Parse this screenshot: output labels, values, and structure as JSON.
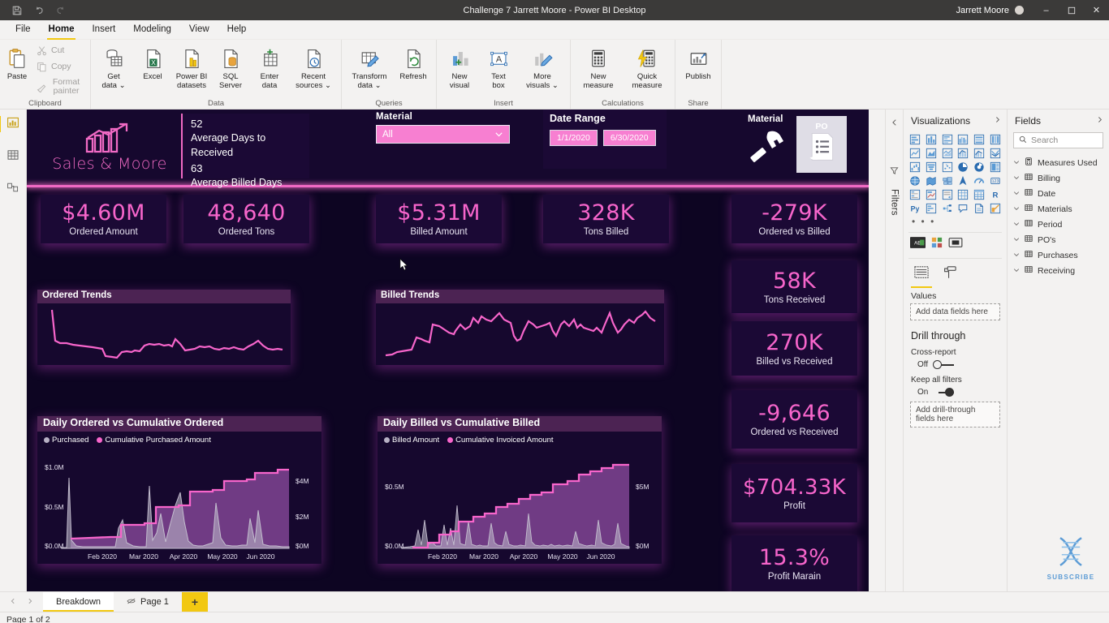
{
  "titlebar": {
    "title": "Challenge 7 Jarrett Moore - Power BI Desktop",
    "user": "Jarrett Moore",
    "save_icon": "save-icon",
    "undo_icon": "undo-icon",
    "redo_icon": "redo-icon",
    "minimize": "–",
    "maximize": "❐",
    "close": "✕"
  },
  "ribbon": {
    "tabs": [
      {
        "label": "File",
        "active": false
      },
      {
        "label": "Home",
        "active": true
      },
      {
        "label": "Insert",
        "active": false
      },
      {
        "label": "Modeling",
        "active": false
      },
      {
        "label": "View",
        "active": false
      },
      {
        "label": "Help",
        "active": false
      }
    ],
    "groups": [
      {
        "name": "Clipboard",
        "items": [
          {
            "label": "Paste",
            "icon": "paste-icon"
          },
          {
            "label": "Cut",
            "icon": "scissors-icon"
          },
          {
            "label": "Copy",
            "icon": "copy-icon"
          },
          {
            "label": "Format painter",
            "icon": "format-painter-icon"
          }
        ]
      },
      {
        "name": "Data",
        "items": [
          {
            "label": "Get data ⌄",
            "icon": "get-data-icon"
          },
          {
            "label": "Excel",
            "icon": "excel-icon"
          },
          {
            "label": "Power BI datasets",
            "icon": "powerbi-datasets-icon"
          },
          {
            "label": "SQL Server",
            "icon": "sql-server-icon"
          },
          {
            "label": "Enter data",
            "icon": "enter-data-icon"
          },
          {
            "label": "Recent sources ⌄",
            "icon": "recent-sources-icon"
          }
        ]
      },
      {
        "name": "Queries",
        "items": [
          {
            "label": "Transform data ⌄",
            "icon": "transform-data-icon"
          },
          {
            "label": "Refresh",
            "icon": "refresh-icon"
          }
        ]
      },
      {
        "name": "Insert",
        "items": [
          {
            "label": "New visual",
            "icon": "new-visual-icon"
          },
          {
            "label": "Text box",
            "icon": "text-box-icon"
          },
          {
            "label": "More visuals ⌄",
            "icon": "more-visuals-icon"
          }
        ]
      },
      {
        "name": "Calculations",
        "items": [
          {
            "label": "New measure",
            "icon": "new-measure-icon"
          },
          {
            "label": "Quick measure",
            "icon": "quick-measure-icon"
          }
        ]
      },
      {
        "name": "Share",
        "items": [
          {
            "label": "Publish",
            "icon": "publish-icon"
          }
        ]
      }
    ],
    "labels": {
      "paste": "Paste",
      "cut": "Cut",
      "copy": "Copy",
      "format_painter": "Format painter",
      "get_data": "Get",
      "get_data2": "data ⌄",
      "excel": "Excel",
      "excel2": "",
      "pbi": "Power BI",
      "pbi2": "datasets",
      "sql": "SQL",
      "sql2": "Server",
      "enter": "Enter",
      "enter2": "data",
      "recent": "Recent",
      "recent2": "sources ⌄",
      "transform": "Transform",
      "transform2": "data ⌄",
      "refresh": "Refresh",
      "refresh2": "",
      "newvisual": "New",
      "newvisual2": "visual",
      "textbox": "Text",
      "textbox2": "box",
      "morevisuals": "More",
      "morevisuals2": "visuals ⌄",
      "newmeasure": "New",
      "newmeasure2": "measure",
      "quickmeasure": "Quick",
      "quickmeasure2": "measure",
      "publish": "Publish",
      "publish2": "",
      "g_clipboard": "Clipboard",
      "g_data": "Data",
      "g_queries": "Queries",
      "g_insert": "Insert",
      "g_calculations": "Calculations",
      "g_share": "Share"
    }
  },
  "leftrail": {
    "items": [
      {
        "name": "report-view",
        "icon": "report-chart-icon",
        "active": true
      },
      {
        "name": "data-view",
        "icon": "table-grid-icon",
        "active": false
      },
      {
        "name": "model-view",
        "icon": "model-relationship-icon",
        "active": false
      }
    ]
  },
  "report": {
    "brand": {
      "name": "Sales & Moore",
      "logo_icon": "bar-chart-arrow-icon"
    },
    "averages": [
      {
        "value": "52",
        "label": "Average Days to Received"
      },
      {
        "value": "63",
        "label": "Average Billed Days"
      }
    ],
    "slicer": {
      "label": "Material",
      "value": "All",
      "chevron_icon": "chevron-down-icon"
    },
    "date_range": {
      "label": "Date Range",
      "start": "1/1/2020",
      "end": "6/30/2020"
    },
    "material_po": {
      "label": "Material",
      "hammer_icon": "hammer-icon",
      "po_label": "PO",
      "po_icon": "clipboard-list-icon"
    },
    "kpis_top": [
      {
        "value": "$4.60M",
        "label": "Ordered Amount"
      },
      {
        "value": "48,640",
        "label": "Ordered Tons"
      },
      {
        "value": "$5.31M",
        "label": "Billed Amount"
      },
      {
        "value": "328K",
        "label": "Tons Billed"
      },
      {
        "value": "-279K",
        "label": "Ordered vs Billed"
      }
    ],
    "kpis_right": [
      {
        "value": "58K",
        "label": "Tons Received"
      },
      {
        "value": "270K",
        "label": "Billed vs Received"
      },
      {
        "value": "-9,646",
        "label": "Ordered vs Received"
      },
      {
        "value": "$704.33K",
        "label": "Profit"
      },
      {
        "value": "15.3%",
        "label": "Profit Marain"
      }
    ],
    "trends": [
      {
        "title": "Ordered Trends"
      },
      {
        "title": "Billed Trends"
      }
    ],
    "subscribe": {
      "label": "SUBSCRIBE",
      "icon": "dna-helix-icon"
    }
  },
  "chart_data": [
    {
      "type": "line",
      "title": "Ordered Trends",
      "xlabel": "",
      "ylabel": "",
      "legend": [],
      "grid": false,
      "series": [
        {
          "name": "Ordered",
          "color": "#f765cb",
          "values": [
            98,
            62,
            58,
            57,
            55,
            53,
            50,
            49,
            48,
            47,
            46,
            30,
            28,
            27,
            36,
            35,
            34,
            33,
            35,
            34,
            33,
            32,
            44,
            45,
            46,
            45,
            44,
            43,
            44,
            43,
            42,
            52,
            48,
            34,
            33,
            32,
            33,
            32,
            40,
            41,
            40,
            39,
            38,
            37,
            36,
            40,
            41,
            40,
            39,
            38,
            37,
            36,
            35,
            34,
            33,
            32,
            31,
            30,
            32,
            34,
            36,
            38,
            40,
            42,
            40,
            48,
            52,
            44,
            36,
            34,
            33,
            32,
            31,
            32,
            33,
            32
          ]
        }
      ]
    },
    {
      "type": "line",
      "title": "Billed Trends",
      "xlabel": "",
      "ylabel": "",
      "legend": [],
      "grid": false,
      "series": [
        {
          "name": "Billed",
          "color": "#f765cb",
          "values": [
            8,
            9,
            10,
            14,
            15,
            16,
            15,
            14,
            32,
            30,
            28,
            27,
            26,
            48,
            50,
            46,
            44,
            42,
            40,
            38,
            40,
            54,
            52,
            50,
            48,
            62,
            46,
            50,
            58,
            62,
            70,
            66,
            72,
            70,
            68,
            66,
            78,
            74,
            66,
            64,
            68,
            66,
            30,
            26,
            32,
            36,
            34,
            62,
            66,
            56,
            52,
            50,
            52,
            54,
            50,
            58,
            60,
            56,
            48,
            62,
            44,
            56,
            58,
            60,
            56,
            54,
            52,
            58,
            52,
            50,
            46,
            78,
            60,
            52,
            48,
            44,
            42,
            58,
            62,
            60,
            66,
            72,
            70,
            64
          ]
        }
      ]
    },
    {
      "type": "area",
      "title": "Daily Ordered vs Cumulative Ordered",
      "xlabel": "",
      "ylabel": "",
      "legend": [
        "Purchased",
        "Cumulative Purchased Amount"
      ],
      "legend_position": "top",
      "grid": false,
      "x_ticks": [
        "Feb 2020",
        "Mar 2020",
        "Apr 2020",
        "May 2020",
        "Jun 2020"
      ],
      "y_left_ticks": [
        "$0.0M",
        "$0.5M",
        "$1.0M"
      ],
      "y_left_lim": [
        0,
        1000000
      ],
      "y_right_ticks": [
        "$0M",
        "$2M",
        "$4M"
      ],
      "y_right_lim": [
        0,
        5000000
      ],
      "series": [
        {
          "name": "Purchased",
          "color": "#b7b0c4",
          "values": [
            0.02,
            0.02,
            0.9,
            0.1,
            0.04,
            0.03,
            0.03,
            0.02,
            0.03,
            0.02,
            0.02,
            0.03,
            0.02,
            0.03,
            0.02,
            0.02,
            0.03,
            0.02,
            0.02,
            0.02,
            0.03,
            0.02,
            0.02,
            0.02,
            0.2,
            0.12,
            0.05,
            0.03,
            0.02,
            0.02,
            0.02,
            0.02,
            0.78,
            0.09,
            0.05,
            0.35,
            0.08,
            0.06,
            0.32,
            0.22,
            0.12,
            0.58,
            0.3,
            0.18,
            0.1,
            0.06,
            0.05,
            0.04,
            0.04,
            0.03,
            0.03,
            0.04,
            0.05,
            0.06,
            0.6,
            0.18,
            0.06,
            0.04,
            0.04,
            0.05,
            0.05,
            0.04,
            0.04,
            0.05,
            0.4,
            0.12,
            0.06,
            0.42,
            0.1,
            0.05,
            0.05,
            0.04,
            0.04,
            0.04,
            0.04,
            0.03,
            0.03,
            0.03
          ]
        },
        {
          "name": "Cumulative Purchased Amount",
          "color": "#f765cb",
          "values": [
            0.64,
            0.64,
            0.64,
            0.65,
            0.65,
            0.66,
            0.66,
            0.66,
            0.67,
            0.67,
            0.67,
            0.68,
            0.68,
            0.68,
            0.68,
            0.69,
            0.69,
            0.69,
            0.7,
            0.7,
            0.7,
            0.71,
            0.71,
            0.85,
            0.88,
            0.88,
            0.89,
            0.89,
            0.89,
            0.9,
            0.9,
            0.9,
            0.91,
            1.22,
            1.24,
            1.26,
            1.28,
            1.3,
            1.32,
            1.5,
            1.52,
            1.54,
            1.56,
            1.58,
            2.0,
            2.02,
            2.05,
            2.06,
            2.08,
            2.1,
            2.12,
            2.14,
            2.16,
            2.18,
            2.2,
            2.6,
            2.62,
            2.66,
            2.68,
            2.7,
            2.72,
            2.74,
            2.76,
            2.78,
            2.8,
            2.9,
            3.1,
            3.15,
            3.2,
            3.4,
            3.42,
            3.44,
            3.46,
            3.48,
            3.5,
            3.5,
            3.52,
            3.55
          ]
        }
      ]
    },
    {
      "type": "area",
      "title": "Daily Billed vs Cumulative Billed",
      "xlabel": "",
      "ylabel": "",
      "legend": [
        "Billed Amount",
        "Cumulative Invoiced Amount"
      ],
      "legend_position": "top",
      "grid": false,
      "x_ticks": [
        "Feb 2020",
        "Mar 2020",
        "Apr 2020",
        "May 2020",
        "Jun 2020"
      ],
      "y_left_ticks": [
        "$0.0M",
        "$0.5M"
      ],
      "y_left_lim": [
        0,
        600000
      ],
      "y_right_ticks": [
        "$0M",
        "$5M"
      ],
      "y_right_lim": [
        0,
        5500000
      ],
      "series": [
        {
          "name": "Billed Amount",
          "color": "#b7b0c4",
          "values": [
            0.03,
            0.03,
            0.04,
            0.04,
            0.05,
            0.3,
            0.1,
            0.48,
            0.12,
            0.06,
            0.1,
            0.06,
            0.05,
            0.08,
            0.05,
            0.06,
            0.4,
            0.12,
            0.06,
            0.05,
            0.36,
            0.1,
            0.06,
            0.72,
            0.14,
            0.08,
            0.06,
            0.05,
            0.52,
            0.14,
            0.06,
            0.06,
            0.05,
            0.06,
            0.05,
            0.1,
            0.06,
            0.5,
            0.18,
            0.06,
            0.05,
            0.05,
            0.26,
            0.1,
            0.06,
            0.05,
            0.05,
            0.06,
            0.05,
            0.6,
            0.22,
            0.08,
            0.06,
            0.05,
            0.06,
            0.05,
            0.06,
            0.06,
            0.05,
            0.05,
            0.06,
            0.26,
            0.1,
            0.06,
            0.05,
            0.06,
            0.05,
            0.44,
            0.14,
            0.06,
            0.05,
            0.06,
            0.4,
            0.12,
            0.06,
            0.05
          ]
        },
        {
          "name": "Cumulative Invoiced Amount",
          "color": "#f765cb",
          "values": [
            0.03,
            0.03,
            0.03,
            0.04,
            0.04,
            0.05,
            0.05,
            0.06,
            0.22,
            0.24,
            0.26,
            0.28,
            0.3,
            0.31,
            0.32,
            0.46,
            0.47,
            0.48,
            0.49,
            0.5,
            0.51,
            0.52,
            0.53,
            0.68,
            0.9,
            0.92,
            0.94,
            0.96,
            0.98,
            1.0,
            1.02,
            1.04,
            1.06,
            1.32,
            1.34,
            1.36,
            1.38,
            1.4,
            1.62,
            1.64,
            1.66,
            1.68,
            1.7,
            1.72,
            1.74,
            1.76,
            1.78,
            1.8,
            1.82,
            1.84,
            2.2,
            2.22,
            2.24,
            2.26,
            2.28,
            2.3,
            2.32,
            2.34,
            2.36,
            2.38,
            2.6,
            2.8,
            2.82,
            2.84,
            2.86,
            2.88,
            3.0,
            3.2,
            3.22,
            3.3,
            3.4,
            3.42,
            3.6,
            3.62,
            3.7,
            3.9
          ]
        }
      ]
    }
  ],
  "visualizations": {
    "title": "Visualizations",
    "collapse_icon": "chevron-left-icon",
    "expand_icon": "chevron-right-icon",
    "filters_label": "Filters",
    "filter_icon": "funnel-icon",
    "ellipsis": "• • •",
    "fieldwells": [
      {
        "name": "fields-well-tab",
        "icon": "fields-list-icon",
        "active": true
      },
      {
        "name": "format-well-tab",
        "icon": "paint-roller-icon",
        "active": false
      }
    ],
    "wells_label": "Values",
    "dropzone": "Add data fields here",
    "drill": {
      "title": "Drill through",
      "cross_report_label": "Cross-report",
      "cross_report_state": "Off",
      "keep_filters_label": "Keep all filters",
      "keep_filters_state": "On",
      "dropzone": "Add drill-through fields here"
    }
  },
  "fields": {
    "title": "Fields",
    "expand_icon": "chevron-right-icon",
    "search_placeholder": "Search",
    "search_icon": "search-icon",
    "tables": [
      {
        "label": "Measures Used",
        "icon": "measure-calculator-icon"
      },
      {
        "label": "Billing",
        "icon": "table-icon"
      },
      {
        "label": "Date",
        "icon": "table-icon"
      },
      {
        "label": "Materials",
        "icon": "table-icon"
      },
      {
        "label": "Period",
        "icon": "table-icon"
      },
      {
        "label": "PO's",
        "icon": "table-icon"
      },
      {
        "label": "Purchases",
        "icon": "table-icon"
      },
      {
        "label": "Receiving",
        "icon": "table-icon"
      }
    ]
  },
  "pagetabs": {
    "prev_icon": "chevron-left-icon",
    "next_icon": "chevron-right-icon",
    "tabs": [
      {
        "label": "Breakdown",
        "active": true,
        "hidden": false
      },
      {
        "label": "Page 1",
        "active": false,
        "hidden": true
      }
    ],
    "add_label": "+"
  },
  "statusbar": {
    "text": "Page 1 of 2"
  },
  "colors": {
    "accent_pink": "#f765cb",
    "canvas_bg": "#0d0522",
    "card_bg": "#1b0935",
    "header_bg": "#16082e",
    "chart_header": "#4c2353",
    "slicer_pink": "#f77fd1",
    "gray_series": "#b7b0c4",
    "ribbon_bg": "#f3f2f1",
    "yellow_accent": "#f2c811"
  }
}
